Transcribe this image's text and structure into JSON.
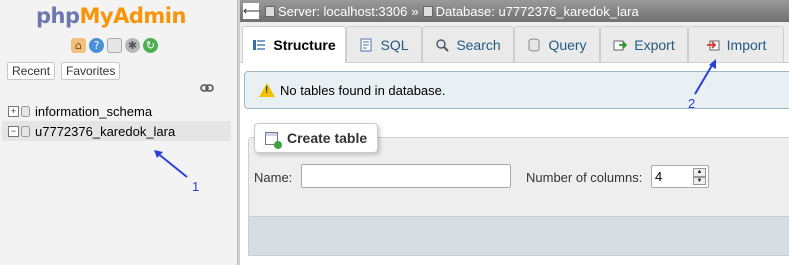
{
  "nav": {
    "logo_php": "php",
    "logo_myadmin": "MyAdmin",
    "icons": [
      "home-icon",
      "help-icon",
      "docs-icon",
      "settings-icon",
      "reload-icon"
    ],
    "recent_label": "Recent",
    "favorites_label": "Favorites",
    "databases": [
      {
        "name": "information_schema",
        "expander": "+"
      },
      {
        "name": "u7772376_karedok_lara",
        "expander": "−"
      }
    ]
  },
  "breadcrumb": {
    "server": "Server: localhost:3306",
    "separator": "»",
    "database": "Database: u7772376_karedok_lara"
  },
  "tabs": [
    {
      "label": "Structure",
      "icon": "structure-icon",
      "active": true
    },
    {
      "label": "SQL",
      "icon": "sql-icon",
      "active": false
    },
    {
      "label": "Search",
      "icon": "search-icon",
      "active": false
    },
    {
      "label": "Query",
      "icon": "query-icon",
      "active": false
    },
    {
      "label": "Export",
      "icon": "export-icon",
      "active": false
    },
    {
      "label": "Import",
      "icon": "import-icon",
      "active": false
    }
  ],
  "notice": "No tables found in database.",
  "create_table": {
    "legend": "Create table",
    "name_label": "Name:",
    "name_value": "",
    "columns_label": "Number of columns:",
    "columns_value": "4"
  },
  "annotations": {
    "one": "1",
    "two": "2",
    "color": "#2a40d8"
  }
}
